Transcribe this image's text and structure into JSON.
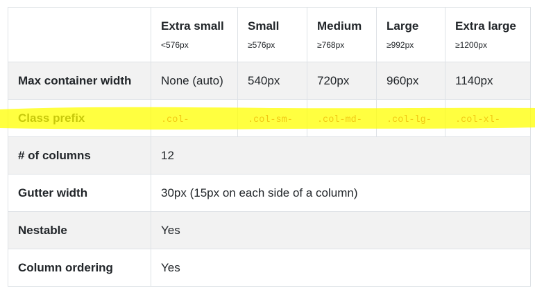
{
  "table": {
    "columns": [
      {
        "name": "Extra small",
        "breakpoint": "<576px"
      },
      {
        "name": "Small",
        "breakpoint": "≥576px"
      },
      {
        "name": "Medium",
        "breakpoint": "≥768px"
      },
      {
        "name": "Large",
        "breakpoint": "≥992px"
      },
      {
        "name": "Extra large",
        "breakpoint": "≥1200px"
      }
    ],
    "rows": {
      "max_width": {
        "label": "Max container width",
        "values": [
          "None (auto)",
          "540px",
          "720px",
          "960px",
          "1140px"
        ]
      },
      "class_prefix": {
        "label": "Class prefix",
        "values": [
          ".col-",
          ".col-sm-",
          ".col-md-",
          ".col-lg-",
          ".col-xl-"
        ]
      },
      "columns": {
        "label": "# of columns",
        "value": "12"
      },
      "gutter": {
        "label": "Gutter width",
        "value": "30px (15px on each side of a column)"
      },
      "nestable": {
        "label": "Nestable",
        "value": "Yes"
      },
      "ordering": {
        "label": "Column ordering",
        "value": "Yes"
      }
    }
  },
  "highlight": {
    "color": "#ffff00",
    "row": "Class prefix"
  }
}
